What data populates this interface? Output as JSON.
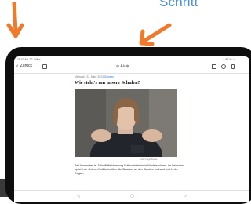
{
  "corner_text": "Schritt",
  "status_bar": {
    "time": "11:37  Mi. 22. März",
    "right": "⌁ 87 % ▭"
  },
  "toolbar": {
    "back_label": "Zurück",
    "font_controls": "⊖  Aᴬ  ⊕"
  },
  "article": {
    "meta": "Mittwoch, 22. März 2023",
    "meta_tag": "Schulen",
    "headline": "Wie steht's um unsere Schulen?",
    "caption": "Foto: Imago/Blanke",
    "body": "Seit November ist Julia Willie Hamburg Kultusministerin in Niedersachsen. Im Interview spricht die Grünen-Politikerin über die Situation an den Schulen im Land und in der Region."
  },
  "bottom_tabs": [
    "◁",
    "▢",
    "▷"
  ],
  "colors": {
    "accent_text": "#4a90d9",
    "arrow": "#f07a2c",
    "bezel": "#0e0e0e"
  }
}
